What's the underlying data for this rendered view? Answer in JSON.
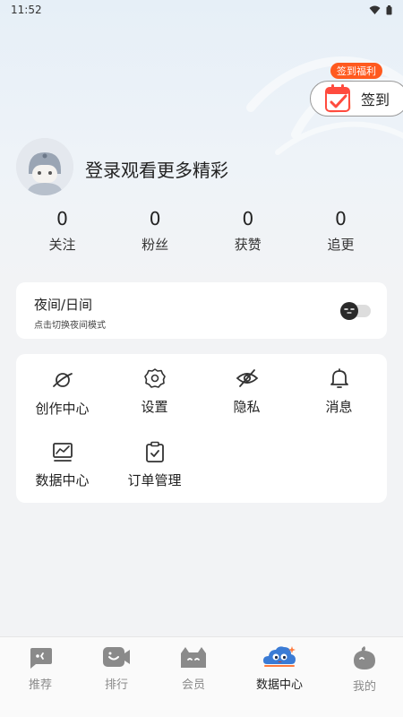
{
  "status_bar": {
    "time": "11:52"
  },
  "checkin": {
    "badge": "签到福利",
    "label": "签到"
  },
  "profile": {
    "login_prompt": "登录观看更多精彩"
  },
  "stats": [
    {
      "value": "0",
      "label": "关注"
    },
    {
      "value": "0",
      "label": "粉丝"
    },
    {
      "value": "0",
      "label": "获赞"
    },
    {
      "value": "0",
      "label": "追更"
    }
  ],
  "night_mode": {
    "title": "夜间/日间",
    "subtitle": "点击切换夜间模式",
    "enabled": false
  },
  "menu": [
    {
      "label": "创作中心",
      "icon": "planet-icon"
    },
    {
      "label": "设置",
      "icon": "gear-icon"
    },
    {
      "label": "隐私",
      "icon": "eye-off-icon"
    },
    {
      "label": "消息",
      "icon": "bell-icon"
    },
    {
      "label": "数据中心",
      "icon": "chart-icon"
    },
    {
      "label": "订单管理",
      "icon": "clipboard-icon"
    }
  ],
  "tabs": [
    {
      "label": "推荐",
      "icon": "recommend-icon",
      "active": false
    },
    {
      "label": "排行",
      "icon": "ranking-icon",
      "active": false
    },
    {
      "label": "会员",
      "icon": "member-icon",
      "active": false
    },
    {
      "label": "数据中心",
      "icon": "data-center-icon",
      "active": true
    },
    {
      "label": "我的",
      "icon": "profile-icon",
      "active": false
    }
  ],
  "colors": {
    "accent": "#ff5a1f",
    "tab_active": "#3a7bd5"
  }
}
